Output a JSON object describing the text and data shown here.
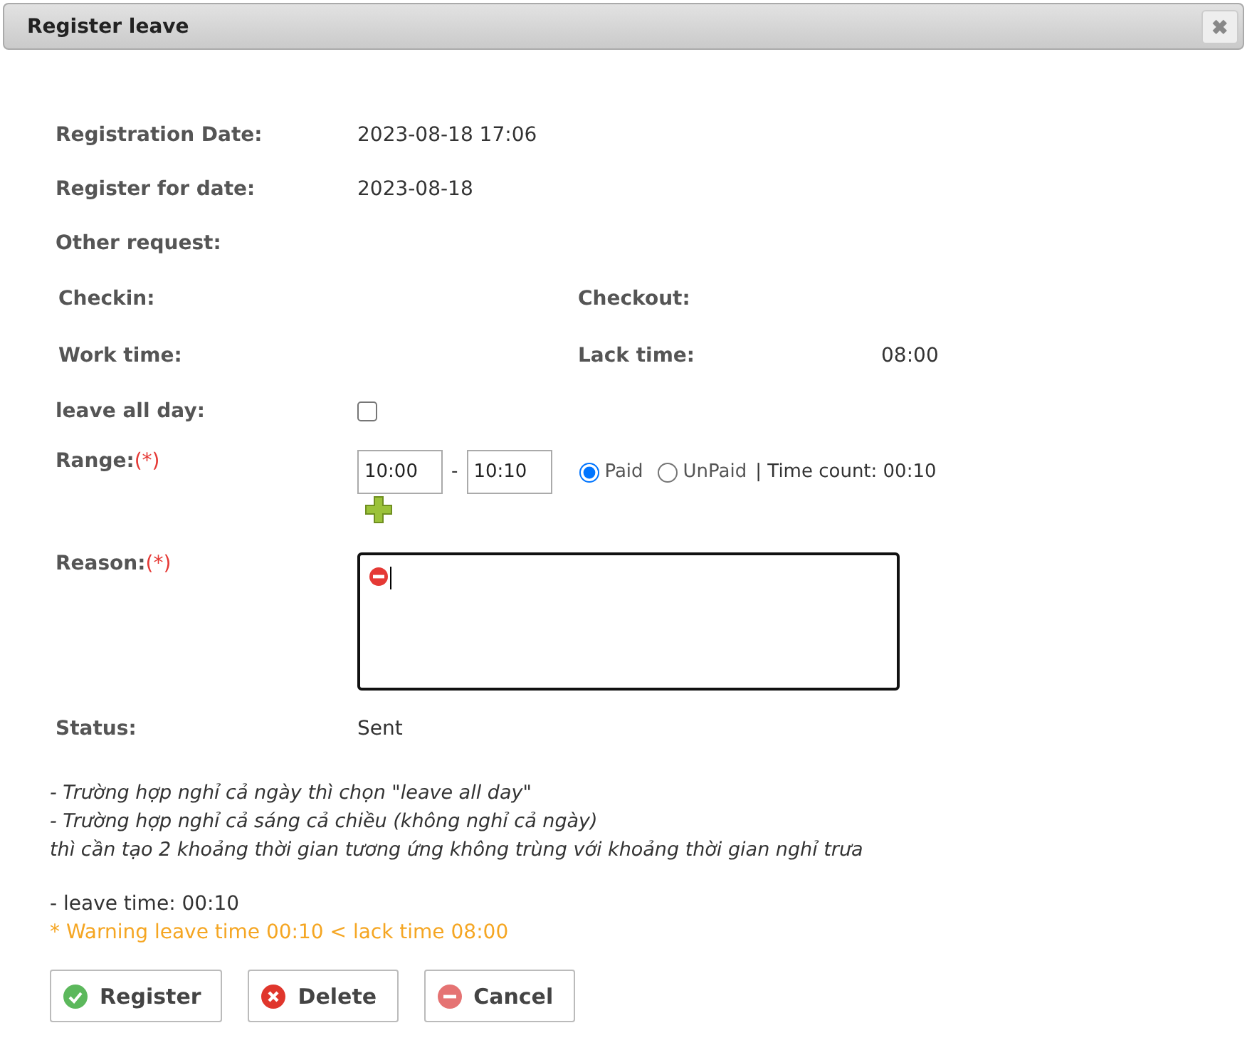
{
  "window": {
    "title": "Register leave",
    "close_icon": "✖"
  },
  "info_rows": [
    {
      "label": "Registration Date:",
      "value": "2023-08-18 17:06"
    },
    {
      "label": "Register for date:",
      "value": "2023-08-18"
    },
    {
      "label": "Other request:"
    }
  ],
  "pair_rows": [
    {
      "left_label": "Checkin:",
      "right_label": "Checkout:"
    },
    {
      "left_label": "Work time:",
      "right_label": "Lack time:",
      "right_value": "08:00"
    }
  ],
  "leave_all_day": {
    "label": "leave all day:",
    "checked": false
  },
  "range": {
    "label": "Range:",
    "required": "(*)",
    "from": "10:00",
    "separator": "-",
    "to": "10:10",
    "options": [
      {
        "label": "Paid",
        "selected": true
      },
      {
        "label": "UnPaid",
        "selected": false
      }
    ],
    "time_count": "| Time count: 00:10"
  },
  "reason": {
    "label": "Reason:",
    "required": "(*)",
    "invalid": true
  },
  "status": {
    "label": "Status:",
    "value": "Sent"
  },
  "notes": [
    "- Trường hợp nghỉ cả ngày thì chọn \"leave all day\"",
    "- Trường hợp nghỉ cả sáng cả chiều (không nghỉ cả ngày)",
    "thì cần tạo 2 khoảng thời gian tương ứng không trùng với khoảng thời gian nghỉ trưa"
  ],
  "leave_time": "- leave time: 00:10",
  "warning": "* Warning leave time 00:10 < lack time 08:00",
  "buttons": [
    {
      "kind": "ok",
      "label": "Register"
    },
    {
      "kind": "delete",
      "label": "Delete"
    },
    {
      "kind": "cancel",
      "label": "Cancel"
    }
  ]
}
